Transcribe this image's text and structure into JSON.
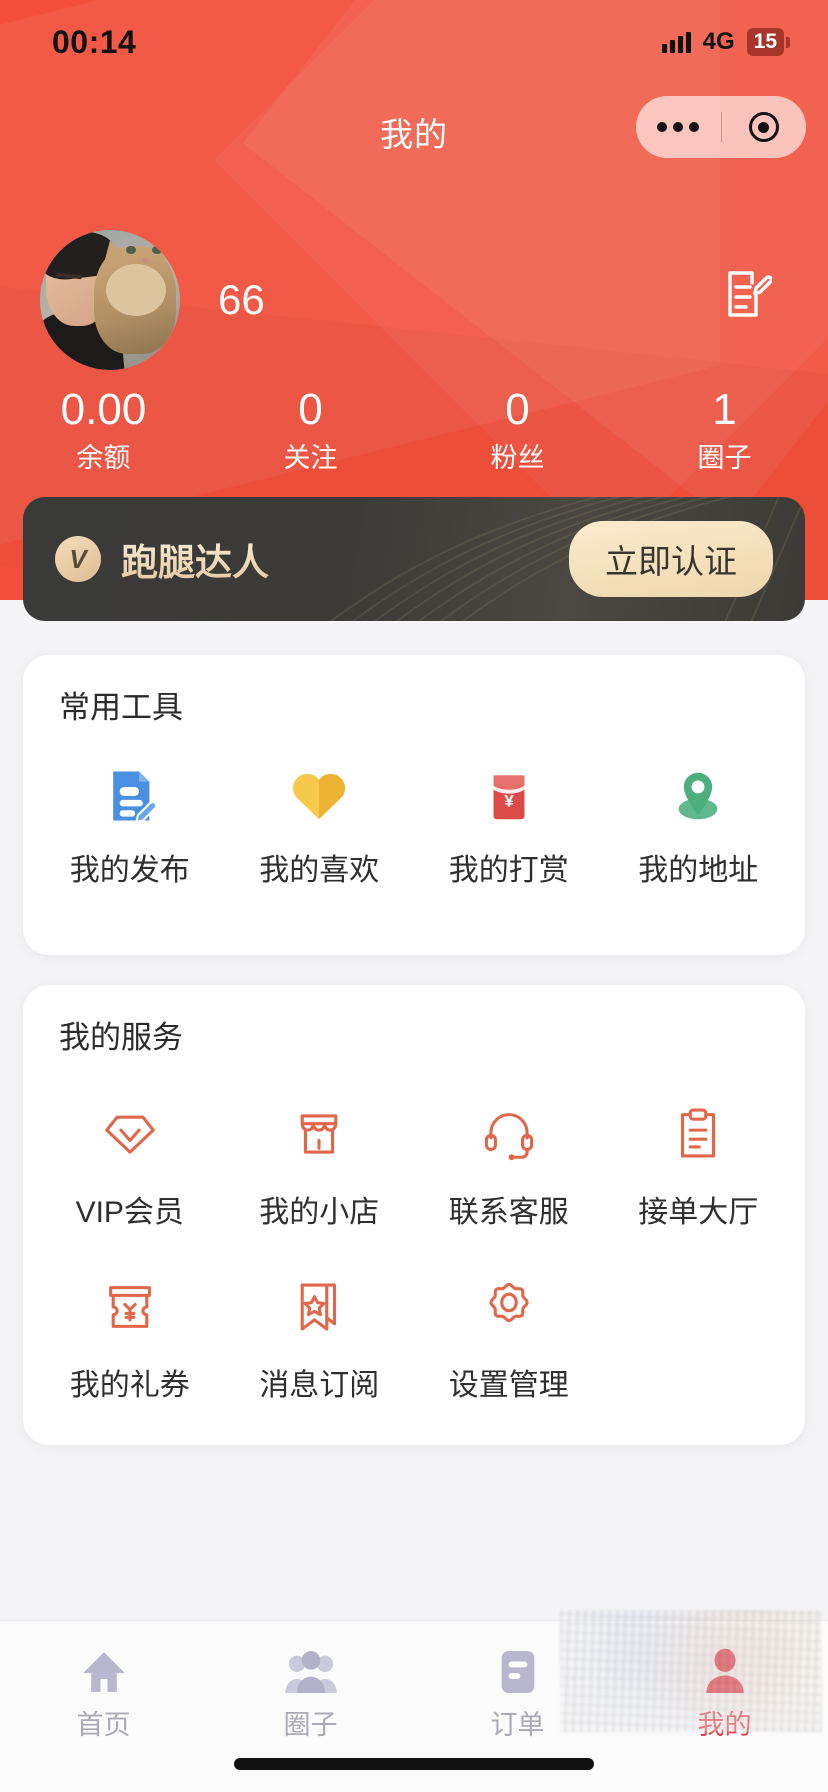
{
  "theme": {
    "brand_red": "#f2503c",
    "accent_orange": "#e2664a",
    "tab_active": "#e8394a",
    "banner_dark": "#3a3a38",
    "banner_gold": "#edd6ac"
  },
  "status_bar": {
    "time": "00:14",
    "network": "4G",
    "battery": "15",
    "signal_icon": "signal-bars-icon",
    "battery_icon": "battery-icon"
  },
  "nav": {
    "title": "我的",
    "more_icon": "more-dots-icon",
    "target_icon": "target-circle-icon"
  },
  "profile": {
    "avatar_icon": "avatar",
    "username": "66",
    "edit_icon": "edit-profile-icon"
  },
  "stats": [
    {
      "value": "0.00",
      "label": "余额"
    },
    {
      "value": "0",
      "label": "关注"
    },
    {
      "value": "0",
      "label": "粉丝"
    },
    {
      "value": "1",
      "label": "圈子"
    }
  ],
  "verify_banner": {
    "badge_icon": "v-badge-icon",
    "badge_text": "V",
    "title": "跑腿达人",
    "button_label": "立即认证"
  },
  "tools_card": {
    "title": "常用工具",
    "items": [
      {
        "label": "我的发布",
        "icon": "document-edit-icon",
        "color": "#4a90e2"
      },
      {
        "label": "我的喜欢",
        "icon": "heart-icon",
        "color": "#f5c242"
      },
      {
        "label": "我的打赏",
        "icon": "red-envelope-yuan-icon",
        "color": "#dd4b48"
      },
      {
        "label": "我的地址",
        "icon": "location-pin-icon",
        "color": "#4caf7d"
      }
    ]
  },
  "services_card": {
    "title": "我的服务",
    "items": [
      {
        "label": "VIP会员",
        "icon": "diamond-vip-icon"
      },
      {
        "label": "我的小店",
        "icon": "shop-icon"
      },
      {
        "label": "联系客服",
        "icon": "headset-support-icon"
      },
      {
        "label": "接单大厅",
        "icon": "clipboard-orders-icon"
      },
      {
        "label": "我的礼券",
        "icon": "coupon-yuan-icon"
      },
      {
        "label": "消息订阅",
        "icon": "bookmark-star-icon"
      },
      {
        "label": "设置管理",
        "icon": "gear-settings-icon"
      }
    ]
  },
  "tabbar": {
    "items": [
      {
        "label": "首页",
        "icon": "home-icon",
        "active": false
      },
      {
        "label": "圈子",
        "icon": "people-circle-icon",
        "active": false
      },
      {
        "label": "订单",
        "icon": "order-list-icon",
        "active": false
      },
      {
        "label": "我的",
        "icon": "user-profile-icon",
        "active": true
      }
    ]
  }
}
